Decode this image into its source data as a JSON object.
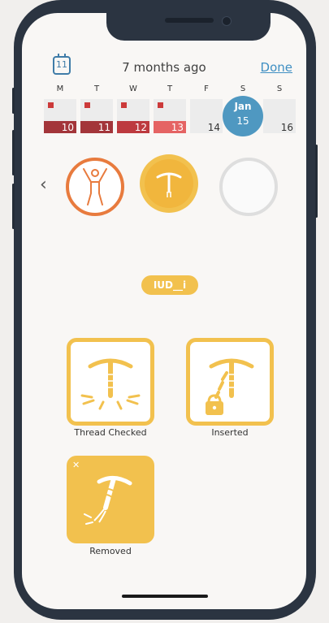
{
  "header": {
    "calendar_icon_day": "11",
    "title": "7 months ago",
    "done_label": "Done"
  },
  "week": {
    "days": [
      {
        "letter": "M",
        "date": "10",
        "marked": true,
        "bar_color": "#a3353a"
      },
      {
        "letter": "T",
        "date": "11",
        "marked": true,
        "bar_color": "#a3353a"
      },
      {
        "letter": "W",
        "date": "12",
        "marked": true,
        "bar_color": "#bd3a3f"
      },
      {
        "letter": "T",
        "date": "13",
        "marked": true,
        "bar_color": "#e56464"
      },
      {
        "letter": "F",
        "date": "14",
        "marked": false,
        "bar_color": ""
      },
      {
        "letter": "S",
        "date": "15",
        "marked": false,
        "bar_color": ""
      },
      {
        "letter": "S",
        "date": "16",
        "marked": false,
        "bar_color": ""
      }
    ],
    "selected": {
      "month": "Jan",
      "date": "15"
    }
  },
  "categories": [
    {
      "name": "activity",
      "icon": "person-arms-up-icon",
      "color": "#e87b3e"
    },
    {
      "name": "iud",
      "icon": "iud-icon",
      "color": "#f2c14e"
    },
    {
      "name": "empty",
      "icon": "",
      "color": "#dedede"
    }
  ],
  "category_label": "IUD__i",
  "options": [
    {
      "label": "Thread Checked",
      "icon": "iud-thread-check-icon",
      "selected": false
    },
    {
      "label": "Inserted",
      "icon": "iud-lock-icon",
      "selected": false
    },
    {
      "label": "Removed",
      "icon": "iud-removed-icon",
      "selected": true
    }
  ],
  "colors": {
    "accent": "#f2c14e",
    "link": "#3f8fc3",
    "today": "#4f98c1"
  }
}
